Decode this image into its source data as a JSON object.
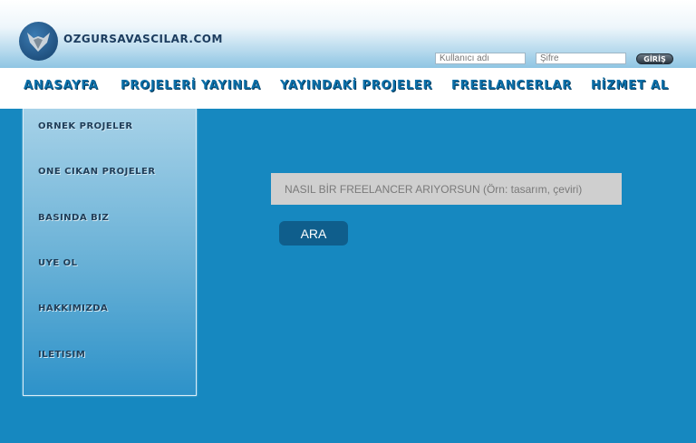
{
  "site": {
    "name": "OZGURSAVASCILAR.COM"
  },
  "login": {
    "username_placeholder": "Kullanıcı adı",
    "password_placeholder": "Şifre",
    "button_label": "GİRİŞ"
  },
  "nav": {
    "items": [
      {
        "label": "ANASAYFA"
      },
      {
        "label": "PROJELERİ YAYINLA"
      },
      {
        "label": "YAYINDAKİ PROJELER"
      },
      {
        "label": "FREELANCERLAR"
      },
      {
        "label": "HİZMET AL"
      }
    ]
  },
  "sidebar": {
    "items": [
      {
        "label": "ORNEK PROJELER"
      },
      {
        "label": "ONE CIKAN PROJELER"
      },
      {
        "label": "BASINDA BIZ"
      },
      {
        "label": "UYE OL"
      },
      {
        "label": "HAKKIMIZDA"
      },
      {
        "label": "ILETISIM"
      }
    ]
  },
  "search": {
    "placeholder": "NASIL BİR FREELANCER ARIYORSUN (Örn: tasarım, çeviri)",
    "button_label": "ARA"
  },
  "colors": {
    "background": "#1688c0",
    "nav_text": "#0c6fa8",
    "search_button": "#0f5e8c"
  }
}
